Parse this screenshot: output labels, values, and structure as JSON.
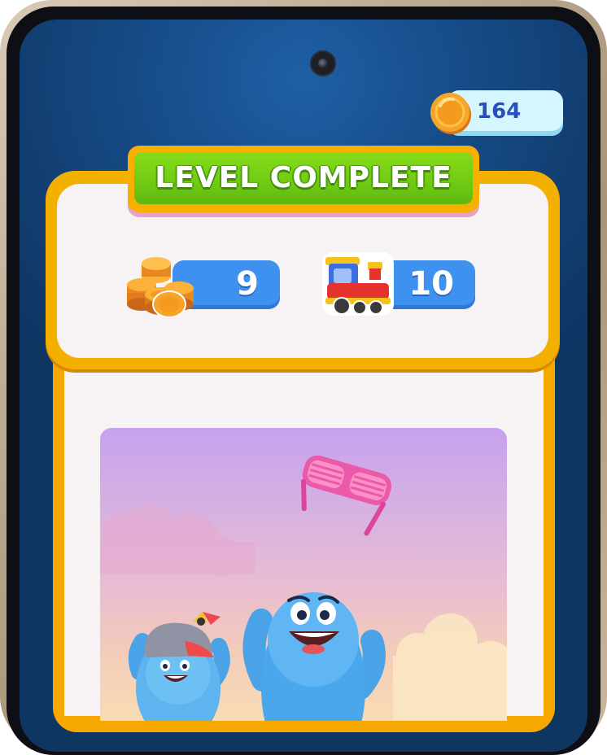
{
  "hud": {
    "coin_total": "164",
    "coin_icon": "gold-coin-icon"
  },
  "level_panel": {
    "title": "LEVEL COMPLETE",
    "rewards": [
      {
        "icon": "coin-stack-icon",
        "value": "9"
      },
      {
        "icon": "toy-train-icon",
        "value": "10"
      }
    ]
  },
  "scene": {
    "items": [
      "pink-shutter-glasses",
      "blue-blob-character-small-with-cap",
      "blue-blob-character-large"
    ]
  },
  "colors": {
    "background": "#174e8c",
    "panel_border": "#f4b000",
    "banner": "#72cc14",
    "reward_pill": "#3f91f0",
    "coin_counter": "#d6f6ff"
  }
}
